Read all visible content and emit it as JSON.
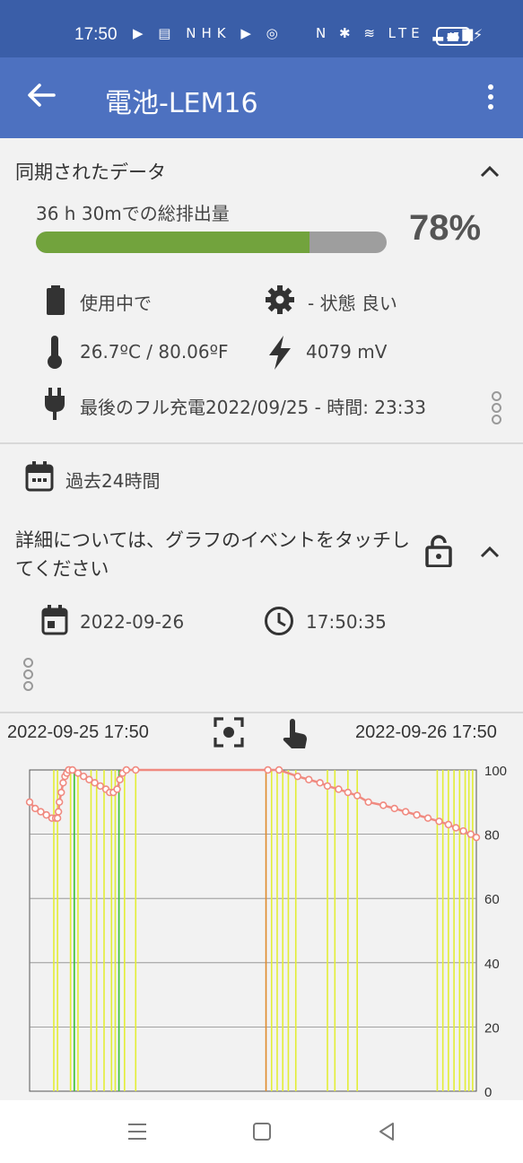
{
  "status_bar": {
    "time": "17:50",
    "left_icons": "▶ ▤ NHK ▶ ◎",
    "right_icons": "N ✱ ≋ LTE ▂▄▆",
    "battery": "45"
  },
  "app_bar": {
    "title": "電池-LEM16",
    "back_icon": "arrow-left",
    "menu_icon": "more-vertical"
  },
  "synced": {
    "title": "同期されたデータ",
    "discharge_label": "36 h 30mでの総排出量",
    "percent_text": "78%",
    "percent_value": 0.78,
    "status_in_use": "使用中で",
    "status_health": "- 状態 良い",
    "temperature": "26.7ºC / 80.06ºF",
    "voltage": "4079 mV",
    "last_full_charge": "最後のフル充電2022/09/25 - 時間: 23:33"
  },
  "period": {
    "label": "過去24時間"
  },
  "details": {
    "title": "詳細については、グラフのイベントをタッチしてください",
    "date": "2022-09-26",
    "time": "17:50:35"
  },
  "chart_header": {
    "start": "2022-09-25 17:50",
    "end": "2022-09-26 17:50"
  },
  "colors": {
    "status_bar": "#3a5ea8",
    "app_bar": "#4d71c0",
    "progress_fill": "#72a33d",
    "progress_track": "#9e9e9e",
    "battery_line": "#f08a80",
    "event_yellow": "#e3ee35",
    "event_green": "#39c234",
    "event_orange": "#e08a2a"
  },
  "chart_data": {
    "type": "line",
    "xlim": [
      0,
      24
    ],
    "ylim": [
      0,
      100
    ],
    "yticks": [
      "100",
      "80",
      "60",
      "40",
      "20",
      "0"
    ],
    "grid": true,
    "series": [
      {
        "x": [
          0.0,
          0.3,
          0.6,
          0.9,
          1.2,
          1.4,
          1.5,
          1.55,
          1.6,
          1.7,
          1.8,
          1.9,
          2.0,
          2.1,
          2.3,
          2.6,
          2.9,
          3.2,
          3.5,
          3.8,
          4.1,
          4.3,
          4.5,
          4.7,
          4.85,
          5.0,
          5.2,
          5.7,
          12.8,
          13.4,
          14.4,
          15.0,
          15.6,
          16.0,
          16.6,
          17.1,
          17.6,
          18.2,
          19.0,
          19.6,
          20.2,
          20.8,
          21.4,
          22.0,
          22.5,
          22.9,
          23.3,
          23.7,
          24.0
        ],
        "y": [
          90,
          88,
          87,
          86,
          85,
          85,
          85,
          87,
          90,
          93,
          96,
          98,
          99,
          100,
          100,
          99,
          98,
          97,
          96,
          95,
          94,
          93,
          93,
          94,
          97,
          99,
          100,
          100,
          100,
          100,
          98,
          97,
          96,
          95,
          94,
          93,
          92,
          90,
          89,
          88,
          87,
          86,
          85,
          84,
          83,
          82,
          81,
          80,
          79
        ]
      }
    ],
    "events": [
      {
        "x": 1.3,
        "color": "yellow"
      },
      {
        "x": 1.5,
        "color": "yellow"
      },
      {
        "x": 2.2,
        "color": "yellow"
      },
      {
        "x": 2.4,
        "color": "green"
      },
      {
        "x": 2.6,
        "color": "yellow"
      },
      {
        "x": 3.3,
        "color": "yellow"
      },
      {
        "x": 3.6,
        "color": "yellow"
      },
      {
        "x": 4.0,
        "color": "yellow"
      },
      {
        "x": 4.4,
        "color": "yellow"
      },
      {
        "x": 4.6,
        "color": "yellow"
      },
      {
        "x": 4.8,
        "color": "green"
      },
      {
        "x": 5.1,
        "color": "yellow"
      },
      {
        "x": 5.7,
        "color": "yellow"
      },
      {
        "x": 12.7,
        "color": "orange"
      },
      {
        "x": 13.0,
        "color": "yellow"
      },
      {
        "x": 13.3,
        "color": "yellow"
      },
      {
        "x": 13.6,
        "color": "yellow"
      },
      {
        "x": 13.9,
        "color": "yellow"
      },
      {
        "x": 14.3,
        "color": "yellow"
      },
      {
        "x": 16.0,
        "color": "yellow"
      },
      {
        "x": 16.4,
        "color": "yellow"
      },
      {
        "x": 17.1,
        "color": "yellow"
      },
      {
        "x": 17.6,
        "color": "yellow"
      },
      {
        "x": 21.9,
        "color": "yellow"
      },
      {
        "x": 22.2,
        "color": "yellow"
      },
      {
        "x": 22.5,
        "color": "yellow"
      },
      {
        "x": 22.8,
        "color": "yellow"
      },
      {
        "x": 23.1,
        "color": "yellow"
      },
      {
        "x": 23.4,
        "color": "yellow"
      },
      {
        "x": 23.6,
        "color": "yellow"
      },
      {
        "x": 23.8,
        "color": "yellow"
      }
    ]
  }
}
